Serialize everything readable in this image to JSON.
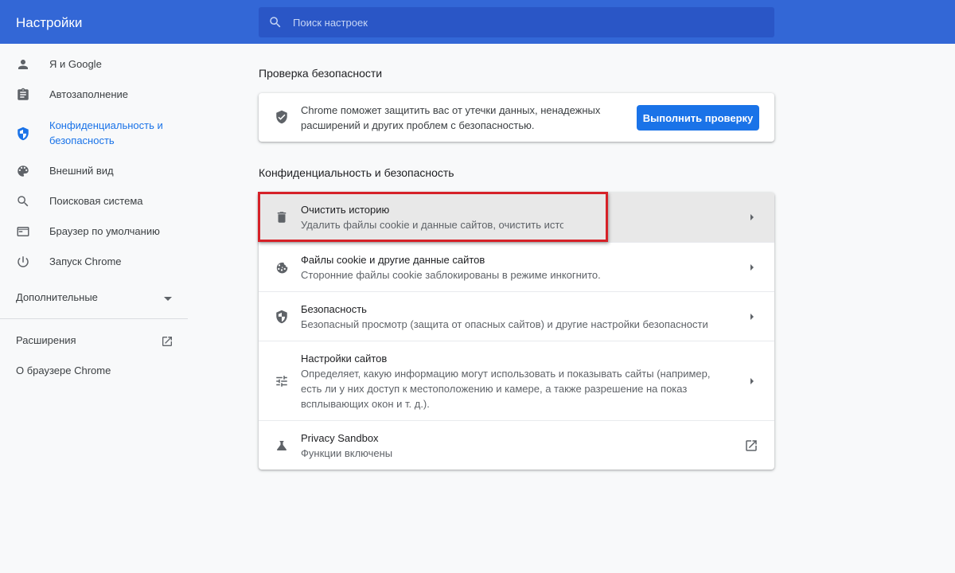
{
  "header": {
    "title": "Настройки",
    "search_placeholder": "Поиск настроек"
  },
  "sidebar": {
    "items": [
      {
        "label": "Я и Google",
        "icon": "person-icon"
      },
      {
        "label": "Автозаполнение",
        "icon": "clipboard-icon"
      },
      {
        "label_line1": "Конфиденциальность и",
        "label_line2": "безопасность",
        "icon": "shield-icon",
        "active": true
      },
      {
        "label": "Внешний вид",
        "icon": "palette-icon"
      },
      {
        "label": "Поисковая система",
        "icon": "search-icon"
      },
      {
        "label": "Браузер по умолчанию",
        "icon": "browser-icon"
      },
      {
        "label": "Запуск Chrome",
        "icon": "power-icon"
      }
    ],
    "advanced_label": "Дополнительные",
    "extensions_label": "Расширения",
    "about_label": "О браузере Chrome"
  },
  "safety_check": {
    "section_title": "Проверка безопасности",
    "text_line1": "Chrome поможет защитить вас от утечки данных, ненадежных",
    "text_line2": "расширений и других проблем с безопасностью.",
    "button_label": "Выполнить проверку"
  },
  "privacy": {
    "section_title": "Конфиденциальность и безопасность",
    "rows": [
      {
        "title": "Очистить историю",
        "subtitle": "Удалить файлы cookie и данные сайтов, очистить историю и кеш",
        "icon": "trash-icon"
      },
      {
        "title": "Файлы cookie и другие данные сайтов",
        "subtitle": "Сторонние файлы cookie заблокированы в режиме инкогнито.",
        "icon": "cookie-icon"
      },
      {
        "title": "Безопасность",
        "subtitle": "Безопасный просмотр (защита от опасных сайтов) и другие настройки безопасности",
        "icon": "shield-icon"
      },
      {
        "title": "Настройки сайтов",
        "subtitle": "Определяет, какую информацию могут использовать и показывать сайты (например, есть ли у них доступ к местоположению и камере, а также разрешение на показ всплывающих окон и т. д.).",
        "icon": "tune-icon"
      },
      {
        "title": "Privacy Sandbox",
        "subtitle": "Функции включены",
        "icon": "flask-icon"
      }
    ]
  },
  "colors": {
    "header": "#3367d6",
    "accent": "#1a73e8",
    "highlight": "#d62128"
  }
}
